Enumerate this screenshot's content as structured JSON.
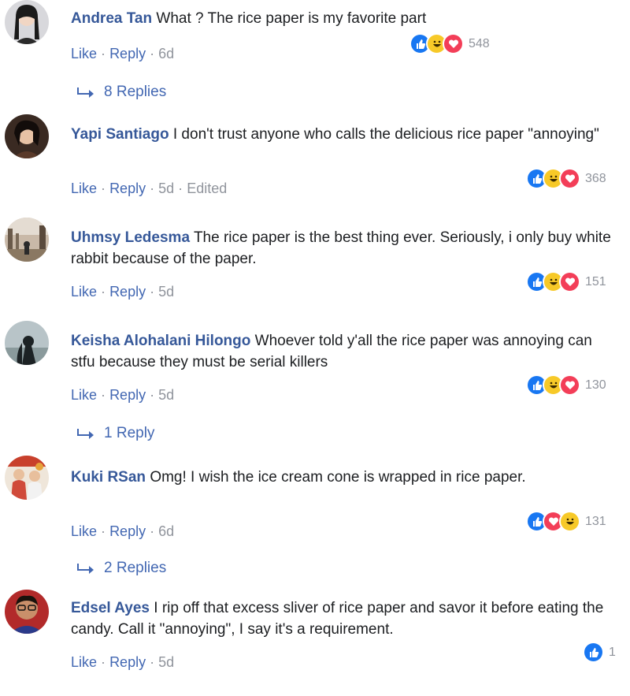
{
  "comments": [
    {
      "author": "Andrea Tan",
      "text": "What ? The rice paper is my favorite part",
      "actions": {
        "like": "Like",
        "reply": "Reply",
        "time": "6d",
        "edited": ""
      },
      "reactions": [
        "like",
        "haha",
        "love"
      ],
      "reaction_count": "548",
      "replies_label": "8 Replies"
    },
    {
      "author": "Yapi Santiago",
      "text": "I don't trust anyone who calls the delicious rice paper \"annoying\"",
      "actions": {
        "like": "Like",
        "reply": "Reply",
        "time": "5d",
        "edited": "Edited"
      },
      "reactions": [
        "like",
        "haha",
        "love"
      ],
      "reaction_count": "368",
      "replies_label": ""
    },
    {
      "author": "Uhmsy Ledesma",
      "text": "The rice paper is the best thing ever. Seriously, i only buy white rabbit because of the paper.",
      "actions": {
        "like": "Like",
        "reply": "Reply",
        "time": "5d",
        "edited": ""
      },
      "reactions": [
        "like",
        "haha",
        "love"
      ],
      "reaction_count": "151",
      "replies_label": ""
    },
    {
      "author": "Keisha Alohalani Hilongo",
      "text": "Whoever told y'all the rice paper was annoying can stfu because they must be serial killers",
      "actions": {
        "like": "Like",
        "reply": "Reply",
        "time": "5d",
        "edited": ""
      },
      "reactions": [
        "like",
        "haha",
        "love"
      ],
      "reaction_count": "130",
      "replies_label": "1 Reply"
    },
    {
      "author": "Kuki RSan",
      "text": "Omg! I wish the ice cream cone is wrapped in rice paper.",
      "actions": {
        "like": "Like",
        "reply": "Reply",
        "time": "6d",
        "edited": ""
      },
      "reactions": [
        "like",
        "love",
        "haha"
      ],
      "reaction_count": "131",
      "replies_label": "2 Replies"
    },
    {
      "author": "Edsel Ayes",
      "text": "I rip off that excess sliver of rice paper and savor it before eating the candy. Call it \"annoying\", I say it's a requirement.",
      "actions": {
        "like": "Like",
        "reply": "Reply",
        "time": "5d",
        "edited": ""
      },
      "reactions": [
        "like"
      ],
      "reaction_count": "1",
      "replies_label": ""
    }
  ],
  "colors": {
    "author": "#365899",
    "link": "#4267b2",
    "meta": "#90949c",
    "like": "#1877f2",
    "haha": "#f7c928",
    "love": "#f33e58"
  },
  "icons": {
    "reply_arrow": "reply-arrow-icon",
    "like": "like-reaction-icon",
    "haha": "haha-reaction-icon",
    "love": "love-reaction-icon"
  }
}
